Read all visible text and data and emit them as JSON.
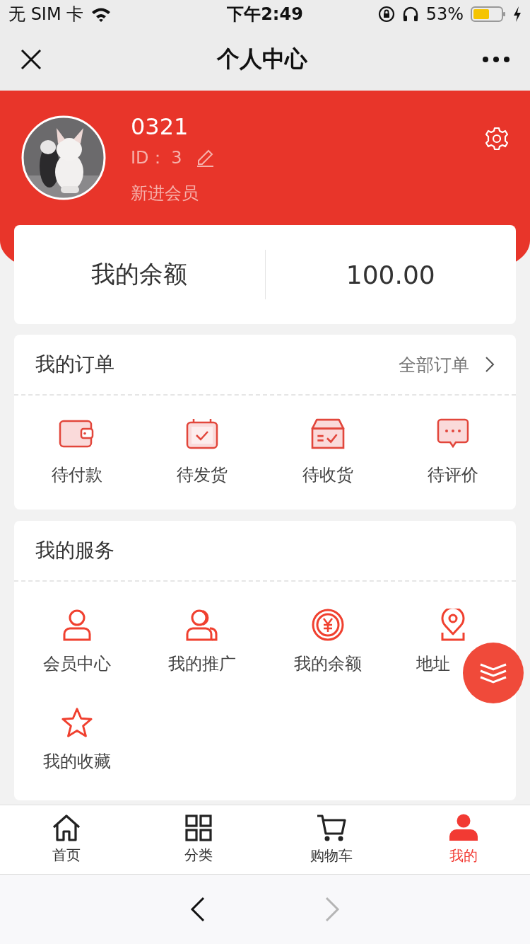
{
  "status_bar": {
    "carrier": "无 SIM 卡",
    "time": "下午2:49",
    "battery": "53%"
  },
  "nav": {
    "title": "个人中心"
  },
  "profile": {
    "name": "0321",
    "id_label": "ID：",
    "id_value": "3",
    "level": "新进会员"
  },
  "balance": {
    "label": "我的余额",
    "value": "100.00"
  },
  "orders": {
    "title": "我的订单",
    "link": "全部订单",
    "items": [
      {
        "label": "待付款"
      },
      {
        "label": "待发货"
      },
      {
        "label": "待收货"
      },
      {
        "label": "待评价"
      }
    ]
  },
  "services": {
    "title": "我的服务",
    "items": [
      {
        "label": "会员中心"
      },
      {
        "label": "我的推广"
      },
      {
        "label": "我的余额"
      },
      {
        "label": "地址"
      },
      {
        "label": "我的收藏"
      }
    ]
  },
  "tab_bar": [
    {
      "label": "首页",
      "selected": false
    },
    {
      "label": "分类",
      "selected": false
    },
    {
      "label": "购物车",
      "selected": false
    },
    {
      "label": "我的",
      "selected": true
    }
  ],
  "browser_bar": {
    "back": {
      "disabled": false
    },
    "forward": {
      "disabled": true
    }
  }
}
